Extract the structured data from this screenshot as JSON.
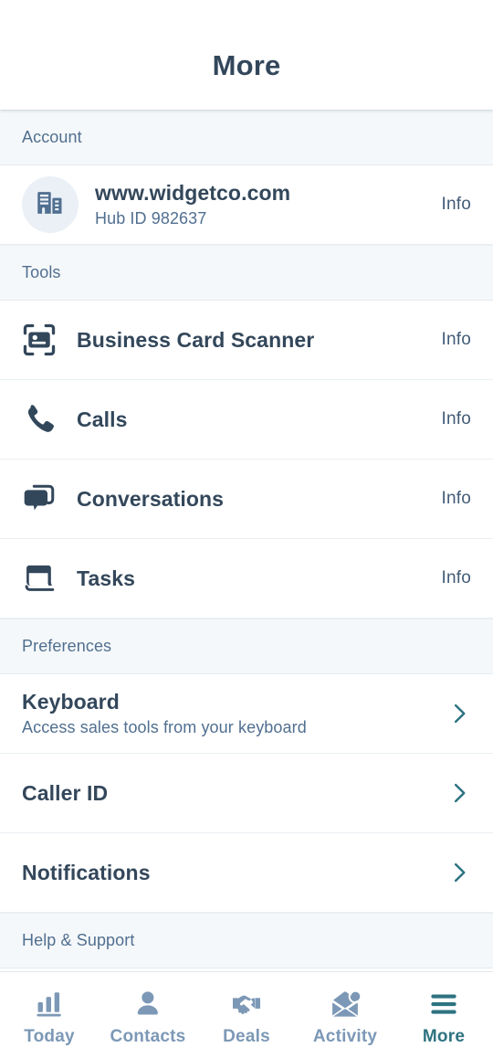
{
  "header": {
    "title": "More"
  },
  "colors": {
    "accent_teal": "#2e7382",
    "text_dark": "#33475b",
    "text_muted": "#516f90",
    "icon_slate": "#7c98b6",
    "section_bg": "#f5f8fa",
    "avatar_bg": "#eaf0f6"
  },
  "sections": [
    {
      "label": "Account",
      "rows": [
        {
          "icon": "office-building-icon",
          "title": "www.widgetco.com",
          "subtitle": "Hub ID 982637",
          "action": "Info",
          "action_type": "info"
        }
      ]
    },
    {
      "label": "Tools",
      "rows": [
        {
          "icon": "business-card-scanner-icon",
          "title": "Business Card Scanner",
          "subtitle": "",
          "action": "Info",
          "action_type": "info"
        },
        {
          "icon": "phone-icon",
          "title": "Calls",
          "subtitle": "",
          "action": "Info",
          "action_type": "info"
        },
        {
          "icon": "chat-bubbles-icon",
          "title": "Conversations",
          "subtitle": "",
          "action": "Info",
          "action_type": "info"
        },
        {
          "icon": "notebook-icon",
          "title": "Tasks",
          "subtitle": "",
          "action": "Info",
          "action_type": "info"
        }
      ]
    },
    {
      "label": "Preferences",
      "rows": [
        {
          "icon": "",
          "title": "Keyboard",
          "subtitle": "Access sales tools from your keyboard",
          "action": "",
          "action_type": "chevron"
        },
        {
          "icon": "",
          "title": "Caller ID",
          "subtitle": "",
          "action": "",
          "action_type": "chevron"
        },
        {
          "icon": "",
          "title": "Notifications",
          "subtitle": "",
          "action": "",
          "action_type": "chevron"
        }
      ]
    },
    {
      "label": "Help & Support",
      "rows": []
    }
  ],
  "tabbar": {
    "tabs": [
      {
        "label": "Today",
        "icon": "bar-chart-icon",
        "active": false
      },
      {
        "label": "Contacts",
        "icon": "person-icon",
        "active": false
      },
      {
        "label": "Deals",
        "icon": "handshake-icon",
        "active": false
      },
      {
        "label": "Activity",
        "icon": "envelope-badge-icon",
        "active": false
      },
      {
        "label": "More",
        "icon": "hamburger-icon",
        "active": true
      }
    ]
  }
}
